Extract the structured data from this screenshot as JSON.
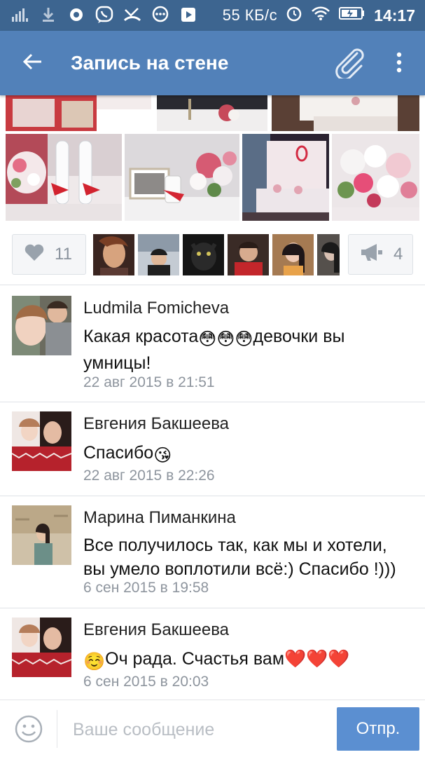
{
  "status_bar": {
    "network_speed": "55 КБ/с",
    "time": "14:17",
    "icons": [
      "signal-icon",
      "download-icon",
      "screen-record-icon",
      "viber-icon",
      "missed-call-icon",
      "messenger-icon",
      "play-icon",
      "alarm-icon",
      "wifi-icon",
      "battery-icon"
    ]
  },
  "app_bar": {
    "title": "Запись на стене",
    "back_icon": "arrow-left-icon",
    "attach_icon": "paperclip-icon",
    "more_icon": "more-vertical-icon"
  },
  "colors": {
    "status_bar": "#3d6590",
    "app_bar": "#5281b9",
    "send_button": "#5b8fd1",
    "secondary_text": "#8e959e"
  },
  "post": {
    "likes_count": "11",
    "shares_count": "4",
    "liker_count_shown": 6
  },
  "comments": [
    {
      "author": "Ludmila Fomicheva",
      "text_parts": [
        "Какая красота",
        "😳😳😳",
        "девочки вы умницы!"
      ],
      "time": "22 авг 2015 в 21:51"
    },
    {
      "author": "Евгения Бакшеева",
      "text_parts": [
        "Спасибо",
        "😘",
        ""
      ],
      "time": "22 авг 2015 в 22:26"
    },
    {
      "author": "Марина Пиманкина",
      "text_parts": [
        "Все получилось так, как мы и хотели, вы умело воплотили всё:) Спасибо !)))",
        "",
        ""
      ],
      "time": "6 сен 2015 в 19:58"
    },
    {
      "author": "Евгения Бакшеева",
      "text_parts": [
        "",
        "☺️",
        "Оч рада. Счастья вам❤️❤️❤️"
      ],
      "time": "6 сен 2015 в 20:03"
    }
  ],
  "composer": {
    "placeholder": "Ваше сообщение",
    "send_label": "Отпр."
  }
}
